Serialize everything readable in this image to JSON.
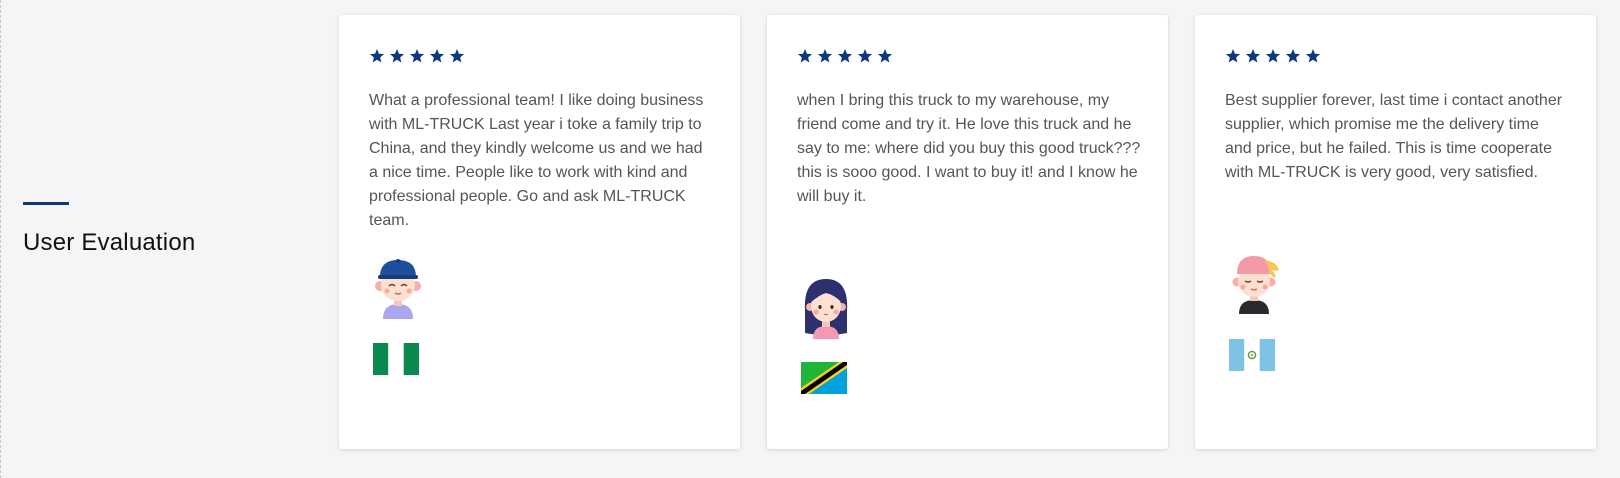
{
  "section": {
    "title": "User Evaluation"
  },
  "colors": {
    "accent": "#0d3a7d",
    "star": "#0d3a7d",
    "text": "#555555",
    "card_background": "#ffffff"
  },
  "reviews": [
    {
      "rating": 5,
      "text": "What a professional team! I like doing business with ML-TRUCK Last year i toke a family trip to China, and they kindly welcome us and we had a nice time. People like to work with kind and professional people. Go and ask ML-TRUCK team.",
      "avatar_icon": "boy-avatar-icon",
      "flag_icon": "nigeria-flag-icon"
    },
    {
      "rating": 5,
      "text": "when I bring this truck to my warehouse, my friend come and try it. He love this truck and he say to me: where did you buy this  good truck??? this is sooo good. I want to buy it! and I know he will buy it.",
      "avatar_icon": "girl-avatar-icon",
      "flag_icon": "tanzania-flag-icon"
    },
    {
      "rating": 5,
      "text": "Best supplier forever, last time i contact another supplier, which promise me the delivery time and price, but he failed. This is time cooperate with ML-TRUCK is very good, very satisfied.",
      "avatar_icon": "man-avatar-icon",
      "flag_icon": "guatemala-flag-icon"
    }
  ]
}
